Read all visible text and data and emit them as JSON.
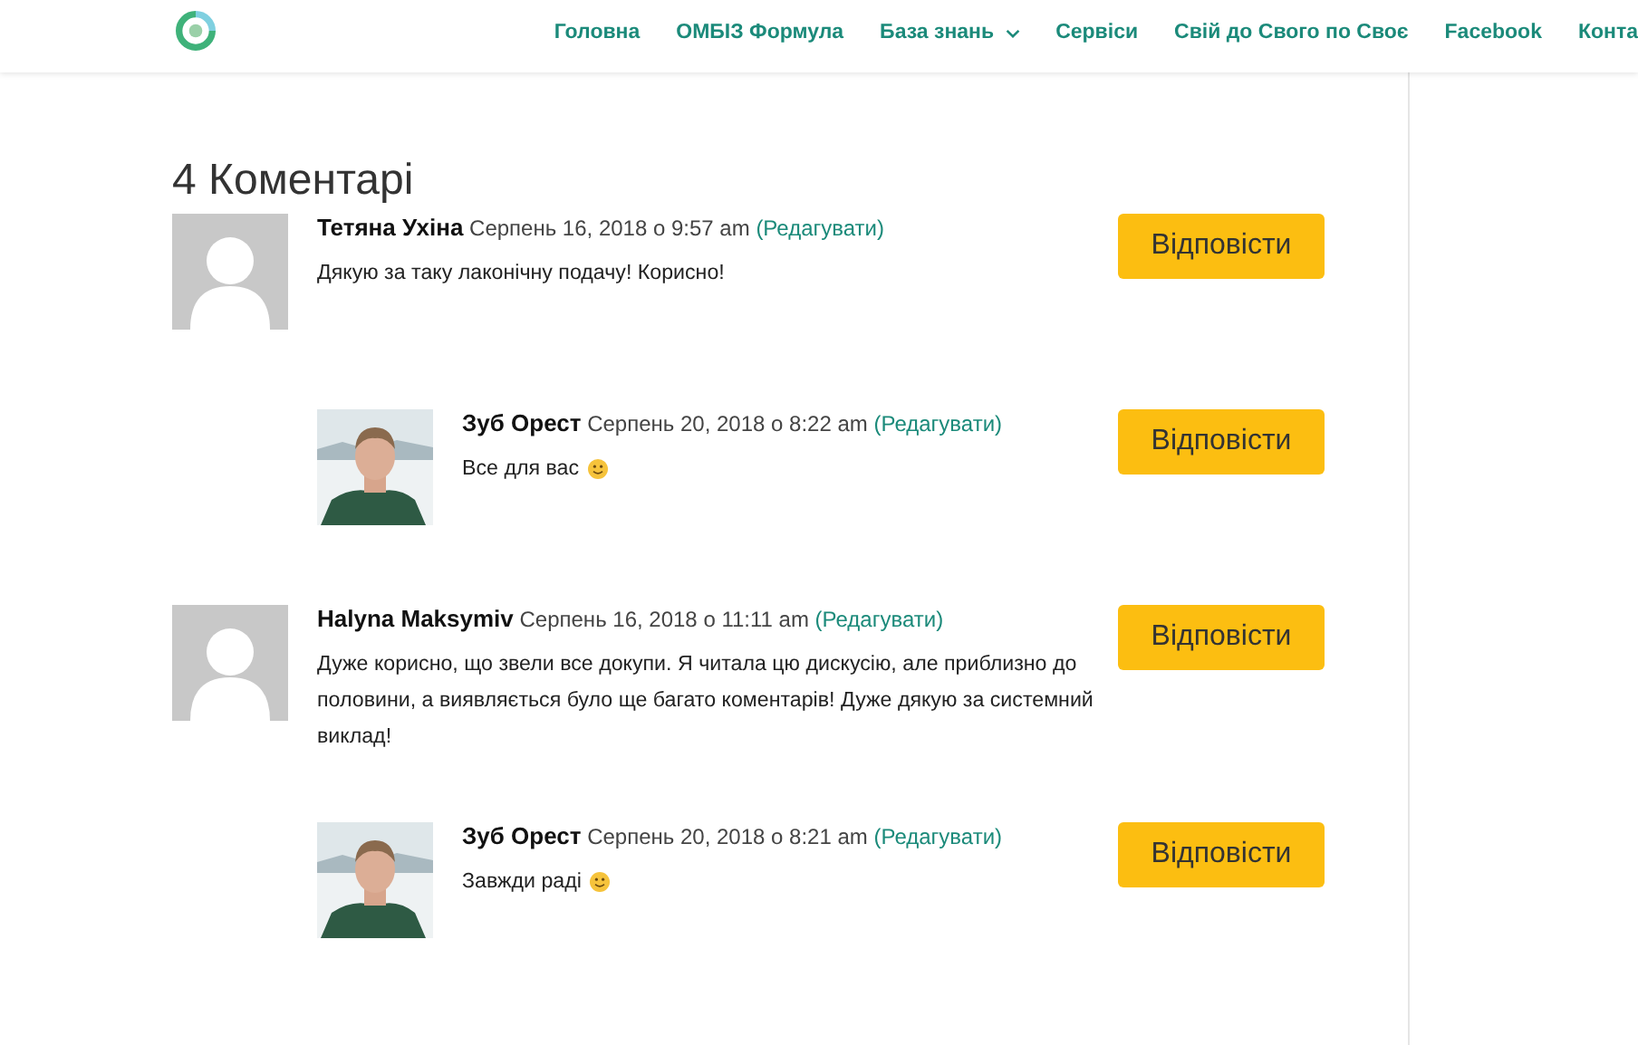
{
  "nav": {
    "items": [
      {
        "label": "Головна",
        "has_dropdown": false
      },
      {
        "label": "ОМБІЗ Формула",
        "has_dropdown": false
      },
      {
        "label": "База знань",
        "has_dropdown": true
      },
      {
        "label": "Сервіси",
        "has_dropdown": false
      },
      {
        "label": "Свій до Свого по Своє",
        "has_dropdown": false
      },
      {
        "label": "Facebook",
        "has_dropdown": false
      },
      {
        "label": "Конта",
        "has_dropdown": false
      }
    ]
  },
  "comments_title": "4 Коментарі",
  "comments": [
    {
      "author": "Тетяна Ухіна",
      "date": "Серпень 16, 2018 о 9:57 am",
      "edit": "(Редагувати)",
      "text": "Дякую за таку лаконічну подачу! Корисно!",
      "smiley": false,
      "avatar": {
        "kind": "default"
      },
      "reply": "Відповісти",
      "children": [
        {
          "author": "Зуб Орест",
          "date": "Серпень 20, 2018 о 8:22 am",
          "edit": "(Редагувати)",
          "text": "Все для вас",
          "smiley": true,
          "reply": "Відповісти"
        }
      ]
    },
    {
      "author": "Halyna Maksymiv",
      "date": "Серпень 16, 2018 о 11:11 am",
      "edit": "(Редагувати)",
      "text": "Дуже корисно, що звели все докупи. Я читала цю дискусію, але приблизно до половини, а виявляється було ще багато коментарів! Дуже дякую за системний виклад!",
      "smiley": false,
      "avatar": {
        "kind": "default"
      },
      "reply": "Відповісти",
      "children": [
        {
          "author": "Зуб Орест",
          "date": "Серпень 20, 2018 о 8:21 am",
          "edit": "(Редагувати)",
          "text": "Завжди раді",
          "smiley": true,
          "reply": "Відповісти"
        }
      ]
    }
  ]
}
